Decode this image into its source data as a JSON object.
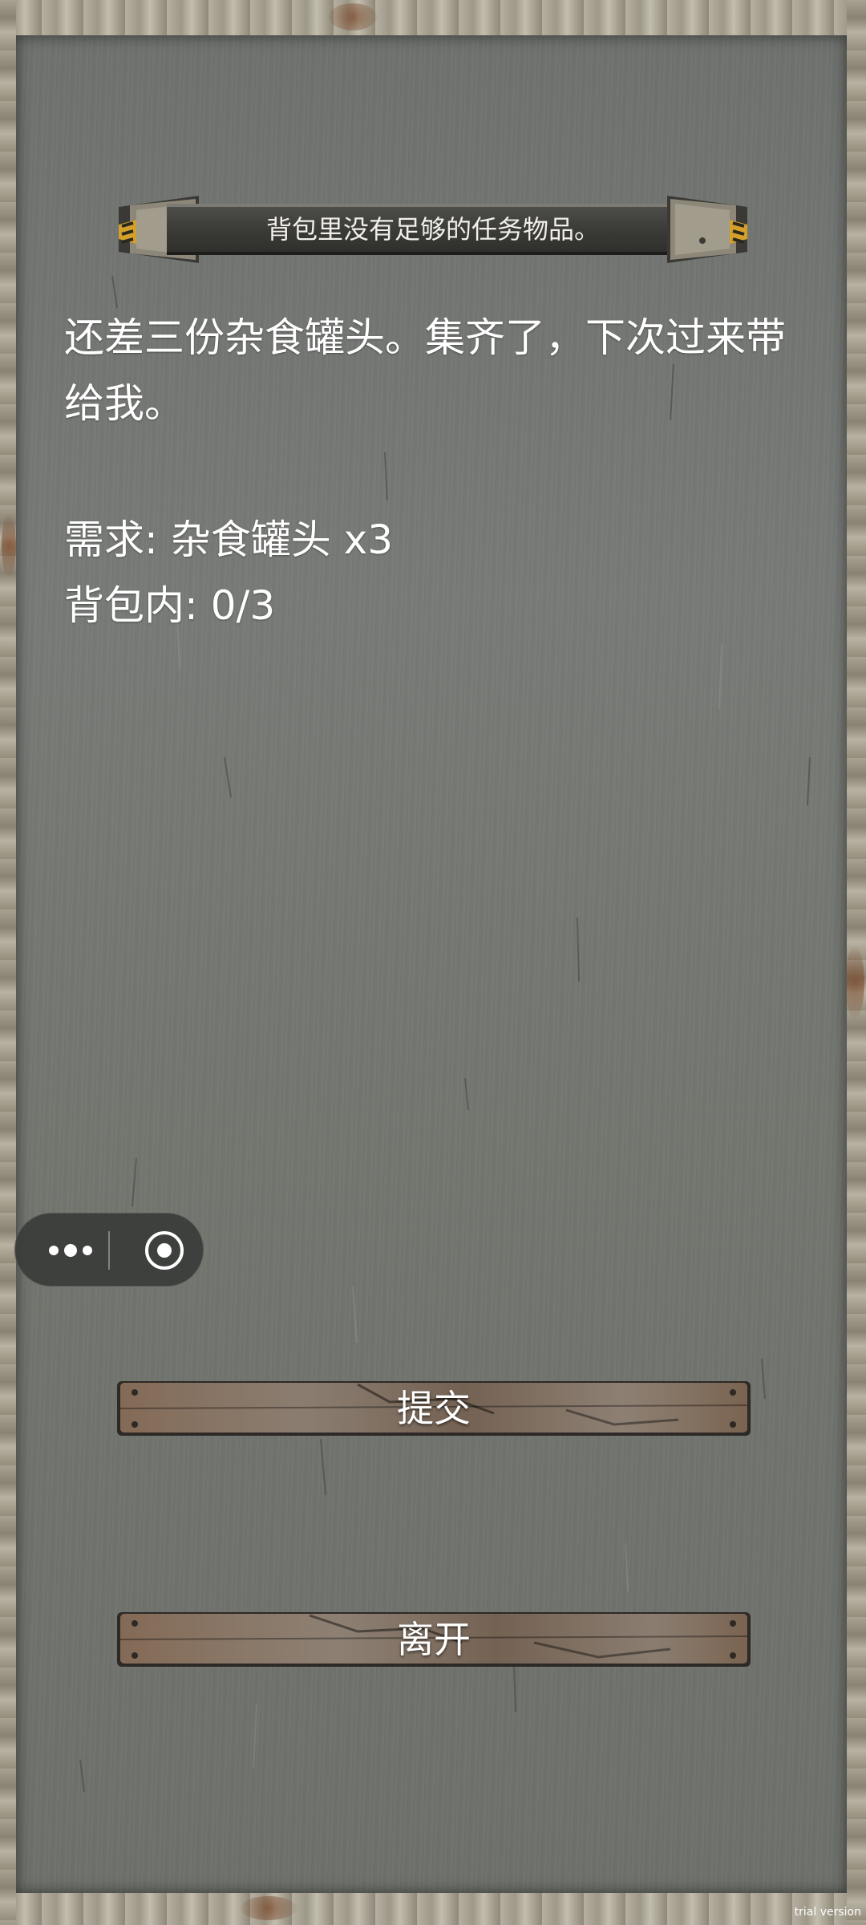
{
  "banner": {
    "text": "背包里没有足够的任务物品。"
  },
  "dialog": {
    "message": "还差三份杂食罐头。集齐了，下次过来带给我。",
    "requirement": "需求: 杂食罐头 x3",
    "inventory": "背包内: 0/3"
  },
  "buttons": {
    "submit_label": "提交",
    "leave_label": "离开"
  },
  "capsule": {
    "more_icon": "more-dots-icon",
    "close_icon": "target-close-icon"
  },
  "watermark": {
    "text": "trial version"
  },
  "colors": {
    "panel": "#73766f",
    "frame": "#a39e90",
    "text": "#ffffff",
    "banner": "#3b3b38",
    "plank": "#7a6a5c"
  }
}
